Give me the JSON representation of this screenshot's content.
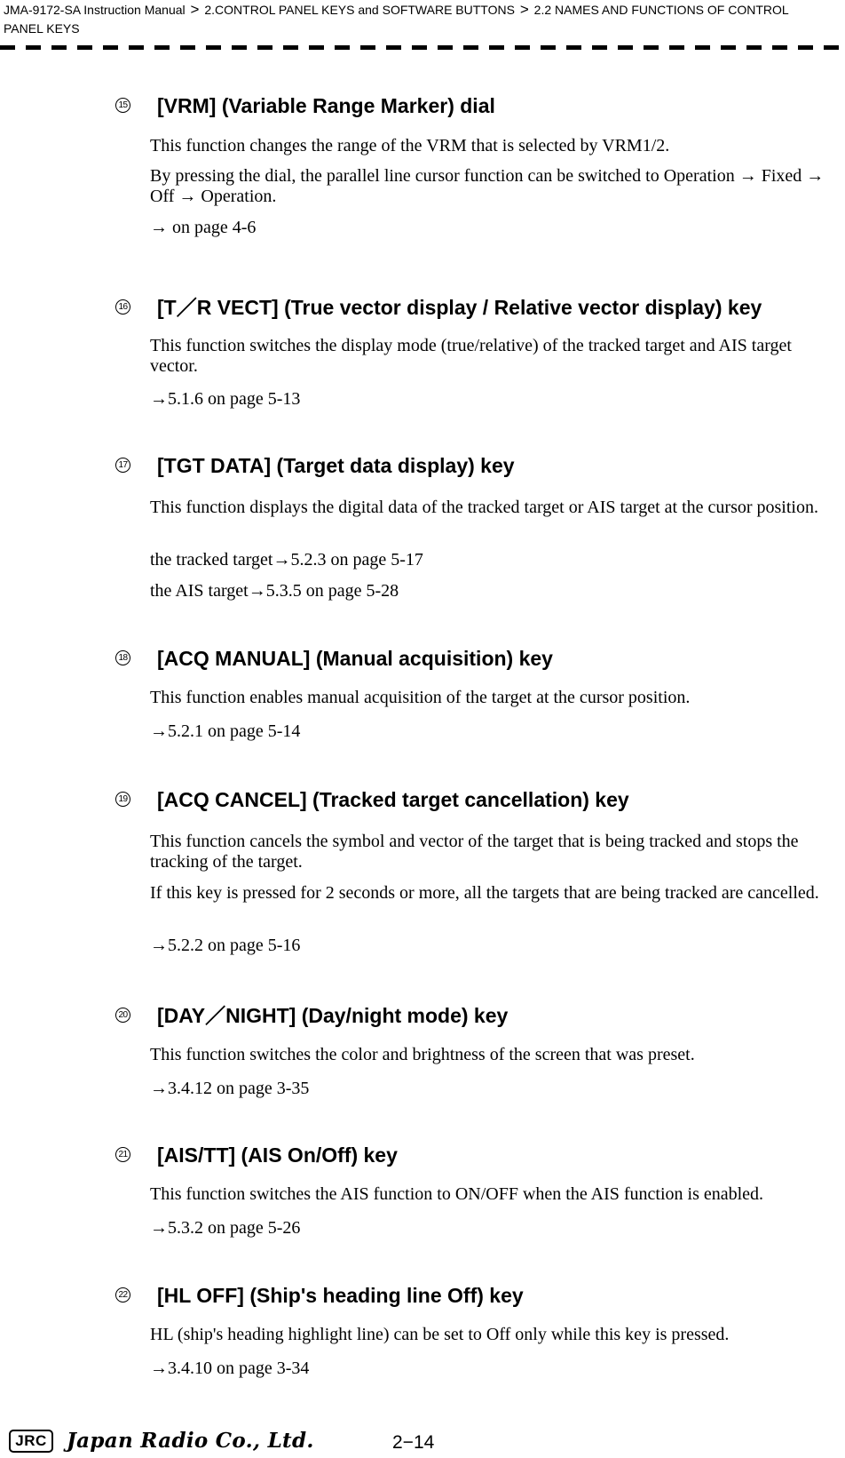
{
  "breadcrumb": {
    "items": [
      "JMA-9172-SA Instruction Manual",
      "2.CONTROL PANEL KEYS and SOFTWARE BUTTONS",
      "2.2  NAMES AND FUNCTIONS OF CONTROL PANEL KEYS"
    ],
    "separator": ">"
  },
  "sections": [
    {
      "number": "15",
      "title": "[VRM] (Variable Range Marker) dial",
      "paragraphs": [
        "This function changes the range of the VRM that is selected by VRM1/2.",
        "By pressing the dial, the parallel line cursor function can be switched to Operation → Fixed → Off → Operation."
      ],
      "refs": [
        "→ on page 4-6"
      ]
    },
    {
      "number": "16",
      "title": "[T／R VECT] (True vector display / Relative vector display) key",
      "paragraphs": [
        "This function switches the display mode (true/relative) of the tracked target and AIS target vector."
      ],
      "refs": [
        "→5.1.6 on page 5-13"
      ]
    },
    {
      "number": "17",
      "title": "[TGT DATA] (Target data display) key",
      "paragraphs": [
        "This function displays the digital data of the tracked target or AIS target at the cursor position."
      ],
      "refs": [
        "the tracked target→5.2.3 on page 5-17",
        "the AIS target→5.3.5 on page 5-28"
      ]
    },
    {
      "number": "18",
      "title": "[ACQ MANUAL] (Manual acquisition) key",
      "paragraphs": [
        "This function enables manual acquisition of the target at the cursor position."
      ],
      "refs": [
        "→5.2.1 on page 5-14"
      ]
    },
    {
      "number": "19",
      "title": "[ACQ CANCEL] (Tracked target cancellation) key",
      "paragraphs": [
        "This function cancels the symbol and vector of the target that is being tracked and stops the tracking of the target.",
        "If this key is pressed for 2 seconds or more, all the targets that are being tracked are cancelled."
      ],
      "refs": [
        "→5.2.2 on page 5-16"
      ]
    },
    {
      "number": "20",
      "title": "[DAY／NIGHT] (Day/night mode) key",
      "paragraphs": [
        "This function switches the color and brightness of the screen that was preset."
      ],
      "refs": [
        "→3.4.12 on page 3-35"
      ]
    },
    {
      "number": "21",
      "title": "[AIS/TT] (AIS On/Off) key",
      "paragraphs": [
        "This function switches the AIS function to ON/OFF when the AIS function is enabled."
      ],
      "refs": [
        "→5.3.2 on page 5-26"
      ]
    },
    {
      "number": "22",
      "title": "[HL OFF] (Ship's heading line Off) key",
      "paragraphs": [
        "HL (ship's heading highlight line) can be set to Off only while this key is pressed."
      ],
      "refs": [
        "→3.4.10 on page 3-34"
      ]
    }
  ],
  "footer": {
    "logo_text": "JRC",
    "company": "Japan Radio Co., Ltd.",
    "page_number": "2−14"
  }
}
